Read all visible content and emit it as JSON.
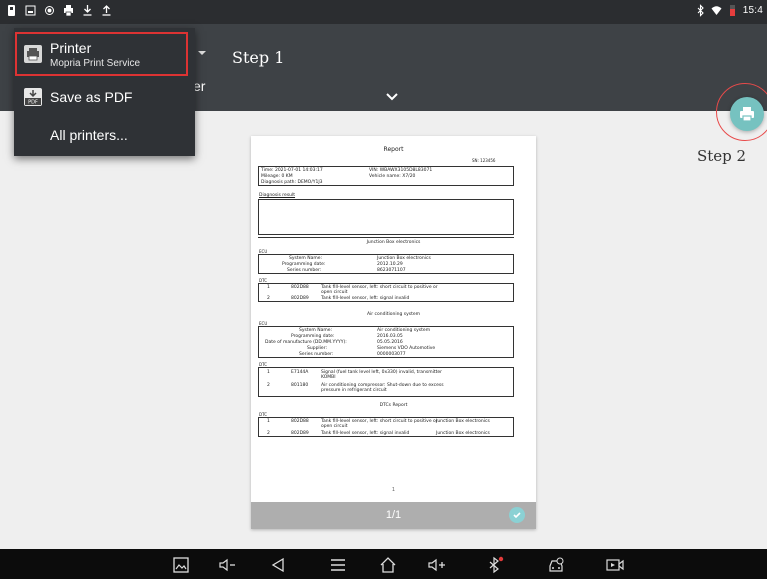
{
  "status_bar": {
    "time": "15:4",
    "left_icons": [
      "notification-icon",
      "gallery-icon",
      "record-icon",
      "print-icon",
      "download-icon",
      "upload-icon"
    ],
    "right_icons": [
      "bluetooth-icon",
      "wifi-icon",
      "battery-icon"
    ]
  },
  "toolbar": {
    "step1": "Step 1",
    "partial_text": "er"
  },
  "menu": {
    "printer_title": "Printer",
    "printer_subtitle": "Mopria Print Service",
    "save_pdf": "Save as PDF",
    "all_printers": "All printers..."
  },
  "step2": "Step 2",
  "preview": {
    "page_number": "1",
    "page_count": "1/1"
  },
  "report": {
    "title": "Report",
    "sn": "SN: 123456",
    "info": {
      "time": "Time: 2021-07-01 14:03:17",
      "vin": "VIN: WBAWX3105D8L83071",
      "mileage": "Mileage: 0 KM",
      "vehicle": "Vehicle name: X7/20",
      "path": "Diagnosis path: DEMO/Y1J3"
    },
    "diag_result": "Diagnosis result",
    "section1": "Junction Box electronics",
    "ecu1": {
      "label": "ECU",
      "rows": [
        [
          "System Name:",
          "Junction Box electronics"
        ],
        [
          "Programming date:",
          "2012.10.29"
        ],
        [
          "Series number:",
          "8623071107"
        ]
      ]
    },
    "dtc1": {
      "label": "DTC",
      "rows": [
        [
          "1",
          "802D88",
          "Tank fill-level sensor, left: short circuit to positive or",
          "open circuit"
        ],
        [
          "2",
          "802D89",
          "Tank fill-level sensor, left: signal invalid",
          ""
        ]
      ]
    },
    "section2": "Air conditioning system",
    "ecu2": {
      "label": "ECU",
      "rows": [
        [
          "System Name:",
          "Air conditioning system"
        ],
        [
          "Programming date:",
          "2016.03.05"
        ],
        [
          "Date of manufacture (DD.MM.YYYY):",
          "05.05.2016"
        ],
        [
          "Supplier:",
          "Siemens VDO Automotive"
        ],
        [
          "Series number:",
          "0000003077"
        ]
      ]
    },
    "dtc2": {
      "label": "DTC",
      "rows": [
        [
          "1",
          "E7144A",
          "Signal (fuel tank level left, 0x330) invalid, transmitter",
          "KOMBI"
        ],
        [
          "2",
          "801180",
          "Air conditioning compressor: Shut-down due to excess",
          "pressure in refrigerant circuit"
        ]
      ]
    },
    "section3": "DTCs Report",
    "dtc3": {
      "label": "DTC",
      "rows": [
        [
          "1",
          "802D88",
          "Tank fill-level sensor, left: short circuit to positive or",
          "open circuit",
          "Junction Box electronics"
        ],
        [
          "2",
          "802D89",
          "Tank fill-level sensor, left: signal invalid",
          "",
          "Junction Box electronics"
        ]
      ]
    }
  },
  "navbar": {
    "icons": [
      "screenshot-icon",
      "volume-down-icon",
      "back-icon",
      "menu-icon",
      "home-icon",
      "volume-up-icon",
      "vci-bluetooth-icon",
      "car-diagnostics-icon",
      "screen-record-icon"
    ]
  },
  "colors": {
    "toolbar": "#3e4246",
    "menu": "#2f3236",
    "fab": "#76c2c0",
    "highlight": "#dd3333",
    "page_bar": "#aeaeae"
  }
}
